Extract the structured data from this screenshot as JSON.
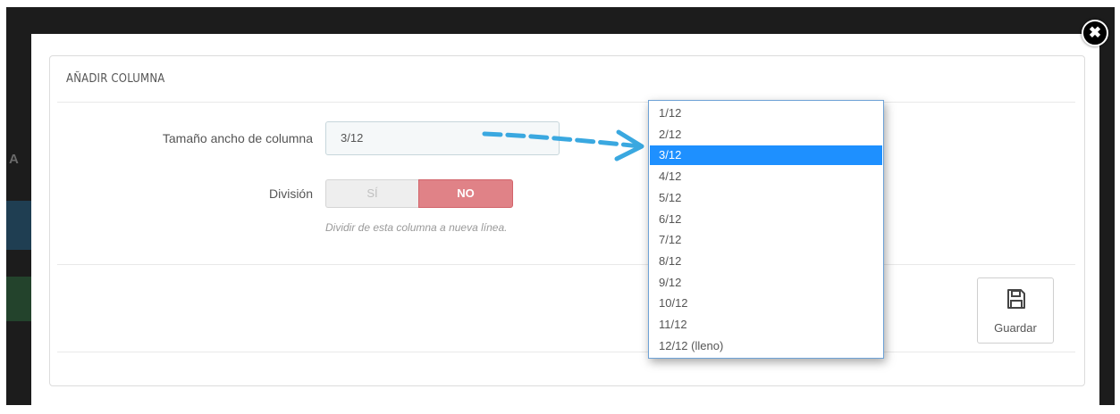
{
  "modal": {
    "heading": "AÑADIR COLUMNA",
    "close_icon": "close-icon",
    "column_width": {
      "label": "Tamaño ancho de columna",
      "value": "3/12"
    },
    "division": {
      "label": "División",
      "yes_label": "SÍ",
      "no_label": "NO",
      "selected": "NO",
      "help": "Dividir de esta columna a nueva línea."
    },
    "save_button": {
      "label": "Guardar",
      "icon": "floppy-disk-icon"
    }
  },
  "dropdown": {
    "options": [
      "1/12",
      "2/12",
      "3/12",
      "4/12",
      "5/12",
      "6/12",
      "7/12",
      "8/12",
      "9/12",
      "10/12",
      "11/12",
      "12/12 (lleno)"
    ],
    "selected_index": 2
  },
  "backdrop": {
    "partial_letter": "A"
  },
  "colors": {
    "toggle_no": "#e08287",
    "selected_option": "#1e90ff",
    "arrow": "#3aa8e0"
  }
}
